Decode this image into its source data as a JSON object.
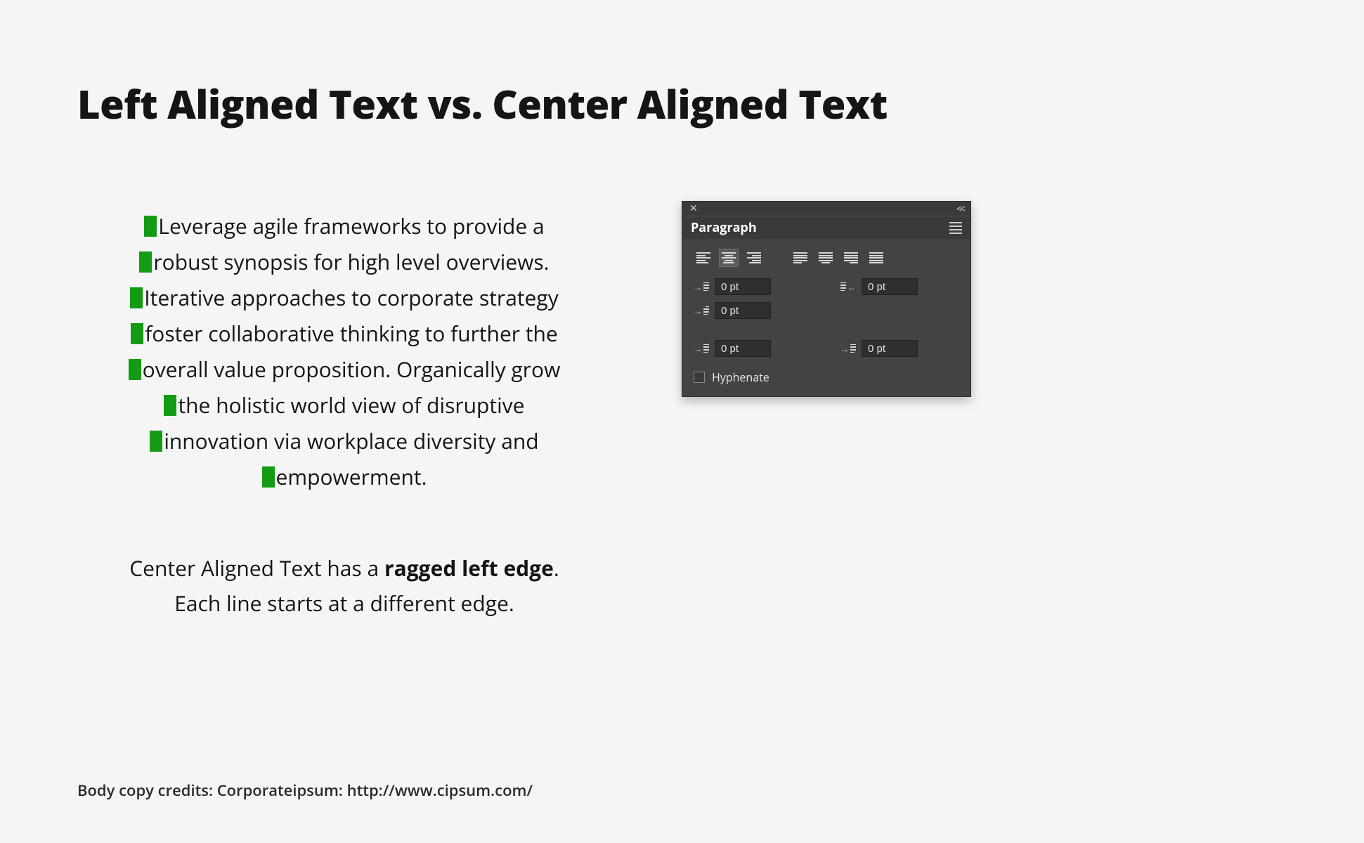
{
  "title": "Left Aligned Text vs. Center Aligned Text",
  "paragraph_lines": [
    "Leverage agile frameworks to provide a",
    "robust synopsis for high level overviews.",
    "Iterative approaches to corporate strategy",
    "foster collaborative thinking to further the",
    "overall value proposition. Organically grow",
    "the holistic world view of disruptive",
    "innovation via workplace diversity and",
    "empowerment."
  ],
  "caption": {
    "line1_before": "Center Aligned Text has a ",
    "line1_bold": "ragged left edge",
    "line1_after": ".",
    "line2": "Each line starts at a different edge."
  },
  "credits": "Body copy credits: Corporateipsum: http://www.cipsum.com/",
  "panel": {
    "title": "Paragraph",
    "active_alignment": "center",
    "indent_left": "0 pt",
    "indent_right": "0 pt",
    "first_line_indent": "0 pt",
    "space_before": "0 pt",
    "space_after": "0 pt",
    "hyphenate_label": "Hyphenate",
    "hyphenate_checked": false
  }
}
